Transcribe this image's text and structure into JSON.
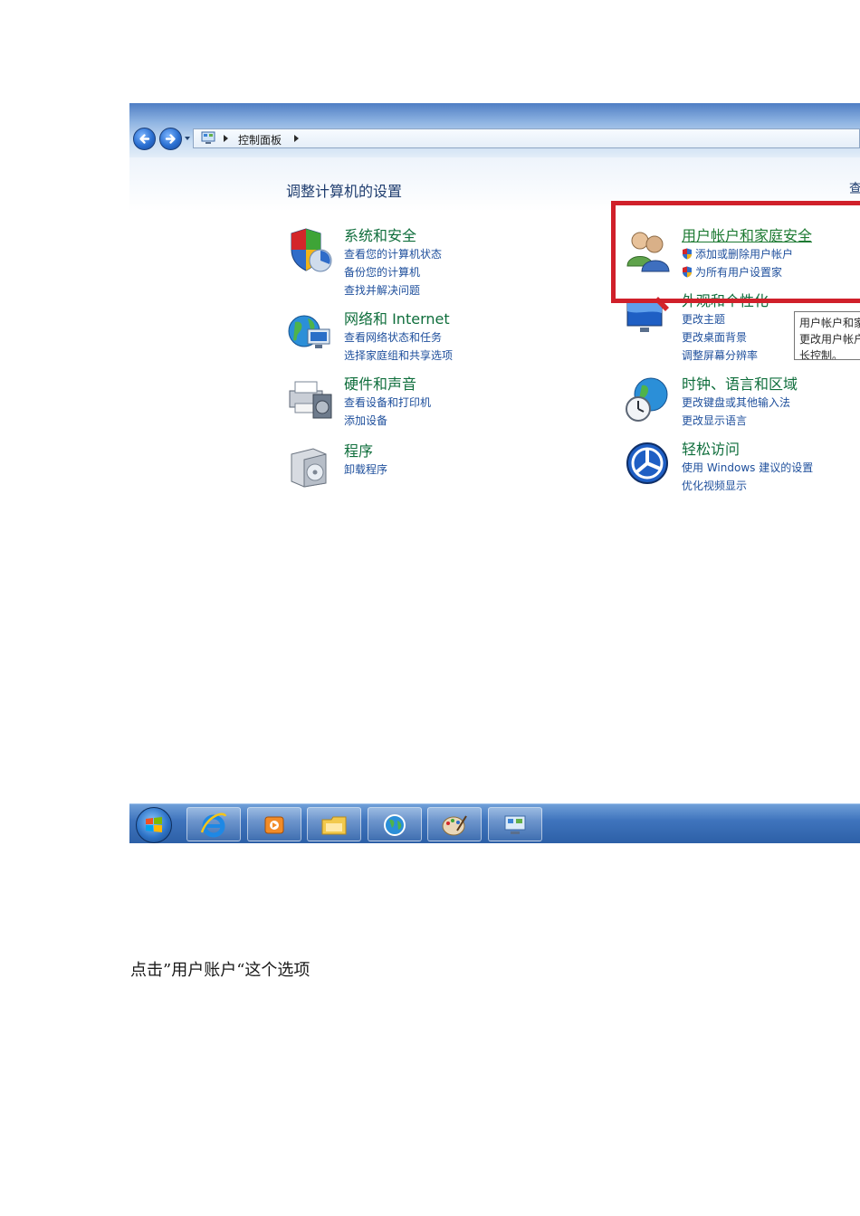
{
  "breadcrumb": {
    "label": "控制面板"
  },
  "content": {
    "page_title": "调整计算机的设置",
    "view_by_partial": "查"
  },
  "left_categories": [
    {
      "title": "系统和安全",
      "links": [
        "查看您的计算机状态",
        "备份您的计算机",
        "查找并解决问题"
      ]
    },
    {
      "title": "网络和 Internet",
      "links": [
        "查看网络状态和任务",
        "选择家庭组和共享选项"
      ]
    },
    {
      "title": "硬件和声音",
      "links": [
        "查看设备和打印机",
        "添加设备"
      ]
    },
    {
      "title": "程序",
      "links": [
        "卸载程序"
      ]
    }
  ],
  "right_categories": [
    {
      "title": "用户帐户和家庭安全",
      "links": [
        "添加或删除用户帐户",
        "为所有用户设置家"
      ]
    },
    {
      "title": "外观和个性化",
      "links": [
        "更改主题",
        "更改桌面背景",
        "调整屏幕分辨率"
      ]
    },
    {
      "title": "时钟、语言和区域",
      "links": [
        "更改键盘或其他输入法",
        "更改显示语言"
      ]
    },
    {
      "title": "轻松访问",
      "links": [
        "使用 Windows 建议的设置",
        "优化视频显示"
      ]
    }
  ],
  "tooltip": {
    "lines": [
      "用户帐户和家",
      "更改用户帐户",
      "长控制。"
    ]
  },
  "taskbar": {
    "items": [
      "start-button",
      "internet-explorer",
      "media-player",
      "file-explorer",
      "network-globe",
      "paint",
      "control-panel"
    ]
  },
  "caption": "点击”用户账户“这个选项",
  "colors": {
    "highlight_frame": "#d0202a",
    "category_title": "#0f6e3c",
    "link": "#1e4f9c"
  }
}
